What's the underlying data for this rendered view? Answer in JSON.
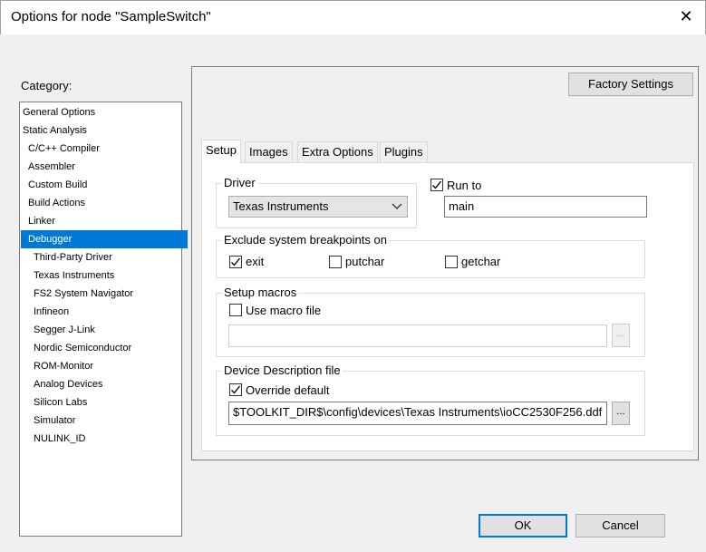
{
  "window": {
    "title": "Options for node \"SampleSwitch\"",
    "close_glyph": "✕"
  },
  "category": {
    "label": "Category:",
    "items": [
      "General Options",
      "Static Analysis",
      "C/C++ Compiler",
      "Assembler",
      "Custom Build",
      "Build Actions",
      "Linker",
      "Debugger",
      "Third-Party Driver",
      "Texas Instruments",
      "FS2 System Navigator",
      "Infineon",
      "Segger J-Link",
      "Nordic Semiconductor",
      "ROM-Monitor",
      "Analog Devices",
      "Silicon Labs",
      "Simulator",
      "NULINK_ID"
    ],
    "selected": "Debugger"
  },
  "factory_settings_label": "Factory Settings",
  "tabs": [
    "Setup",
    "Images",
    "Extra Options",
    "Plugins"
  ],
  "active_tab": "Setup",
  "driver": {
    "group_label": "Driver",
    "selected": "Texas Instruments"
  },
  "run_to": {
    "label": "Run to",
    "checked": true,
    "value": "main"
  },
  "exclude": {
    "group_label": "Exclude system breakpoints on",
    "exit": {
      "label": "exit",
      "checked": true
    },
    "putchar": {
      "label": "putchar",
      "checked": false
    },
    "getchar": {
      "label": "getchar",
      "checked": false
    }
  },
  "macros": {
    "group_label": "Setup macros",
    "use_label": "Use macro file",
    "checked": false,
    "value": "",
    "browse": "..."
  },
  "device": {
    "group_label": "Device Description file",
    "override_label": "Override default",
    "checked": true,
    "value": "$TOOLKIT_DIR$\\config\\devices\\Texas Instruments\\ioCC2530F256.ddf",
    "browse": "..."
  },
  "buttons": {
    "ok": "OK",
    "cancel": "Cancel"
  },
  "colors": {
    "selection": "#0078d7"
  }
}
